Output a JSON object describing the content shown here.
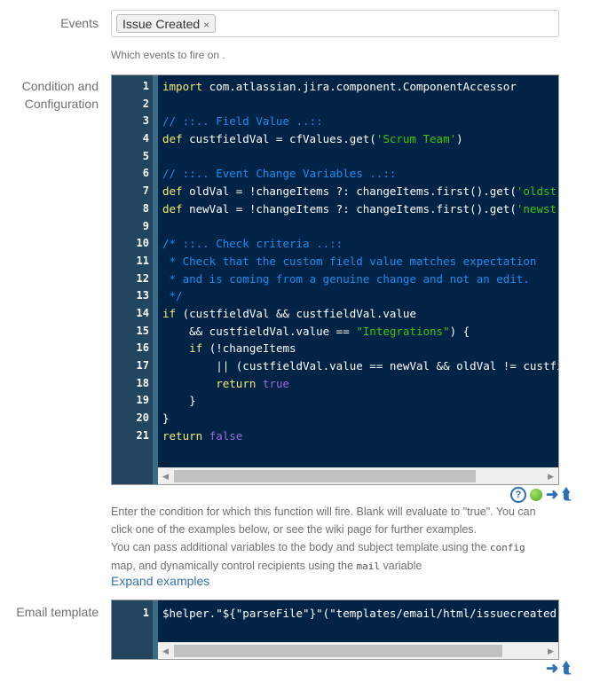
{
  "events": {
    "label": "Events",
    "selected": [
      {
        "label": "Issue Created",
        "remove_icon": "×"
      }
    ],
    "description": "Which events to fire on ."
  },
  "condition": {
    "label_line1": "Condition and",
    "label_line2": "Configuration",
    "lines": [
      [
        {
          "t": "import",
          "c": "kw"
        },
        {
          "t": " com.atlassian.jira.component.ComponentAccessor"
        }
      ],
      [],
      [
        {
          "t": "// ::.. Field Value ..::",
          "c": "cm"
        }
      ],
      [
        {
          "t": "def",
          "c": "kw"
        },
        {
          "t": " custfieldVal = cfValues.get("
        },
        {
          "t": "'Scrum Team'",
          "c": "str"
        },
        {
          "t": ")"
        }
      ],
      [],
      [
        {
          "t": "// ::.. Event Change Variables ..::",
          "c": "cm"
        }
      ],
      [
        {
          "t": "def",
          "c": "kw"
        },
        {
          "t": " oldVal = !changeItems ?: changeItems.first().get("
        },
        {
          "t": "'oldstring'",
          "c": "str"
        }
      ],
      [
        {
          "t": "def",
          "c": "kw"
        },
        {
          "t": " newVal = !changeItems ?: changeItems.first().get("
        },
        {
          "t": "'newstring'",
          "c": "str"
        }
      ],
      [],
      [
        {
          "t": "/* ::.. Check criteria ..::",
          "c": "cm"
        }
      ],
      [
        {
          "t": " * Check that the custom field value matches expectation",
          "c": "cm"
        }
      ],
      [
        {
          "t": " * and is coming from a genuine change and not an edit.",
          "c": "cm"
        }
      ],
      [
        {
          "t": " */",
          "c": "cm"
        }
      ],
      [
        {
          "t": "if",
          "c": "kw"
        },
        {
          "t": " (custfieldVal && custfieldVal.value"
        }
      ],
      [
        {
          "t": "    && custfieldVal.value == "
        },
        {
          "t": "\"Integrations\"",
          "c": "str"
        },
        {
          "t": ") {"
        }
      ],
      [
        {
          "t": "    "
        },
        {
          "t": "if",
          "c": "kw"
        },
        {
          "t": " (!changeItems"
        }
      ],
      [
        {
          "t": "        || (custfieldVal.value == newVal && oldVal != custfieldVal.value"
        }
      ],
      [
        {
          "t": "        "
        },
        {
          "t": "return",
          "c": "kw"
        },
        {
          "t": " "
        },
        {
          "t": "true",
          "c": "bool"
        }
      ],
      [
        {
          "t": "    }"
        }
      ],
      [
        {
          "t": "}"
        }
      ],
      [
        {
          "t": "return",
          "c": "kw"
        },
        {
          "t": " "
        },
        {
          "t": "false",
          "c": "bool"
        }
      ]
    ],
    "help_line1": "Enter the condition for which this function will fire. Blank will evaluate to \"true\". You can",
    "help_line2": "click one of the examples below, or see the wiki page for further examples.",
    "help_line3_pre": "You can pass additional variables to the body and subject template using the ",
    "help_line3_code": "config",
    "help_line4_pre": "map, and dynamically control recipients using the ",
    "help_line4_code": "mail",
    "help_line4_post": " variable",
    "expand_link": "Expand examples",
    "tools": {
      "help": "?",
      "run": "",
      "arrow_right": "➜",
      "arrow_back": "⮬"
    }
  },
  "email_template": {
    "label": "Email template",
    "lines": [
      [
        {
          "t": "$helper.\"${\"parseFile\"}\"(\"templates/email/html/issuecreated.vm\")"
        }
      ]
    ],
    "tools": {
      "arrow_right": "➜",
      "arrow_back": "⮬"
    }
  },
  "colors": {
    "editor_bg": "#012345",
    "gutter_bg": "#224660",
    "keyword": "#f7e96f",
    "comment": "#1d8df0",
    "string": "#3ec40b",
    "boolean": "#9d6ae0",
    "link": "#3572b0"
  }
}
